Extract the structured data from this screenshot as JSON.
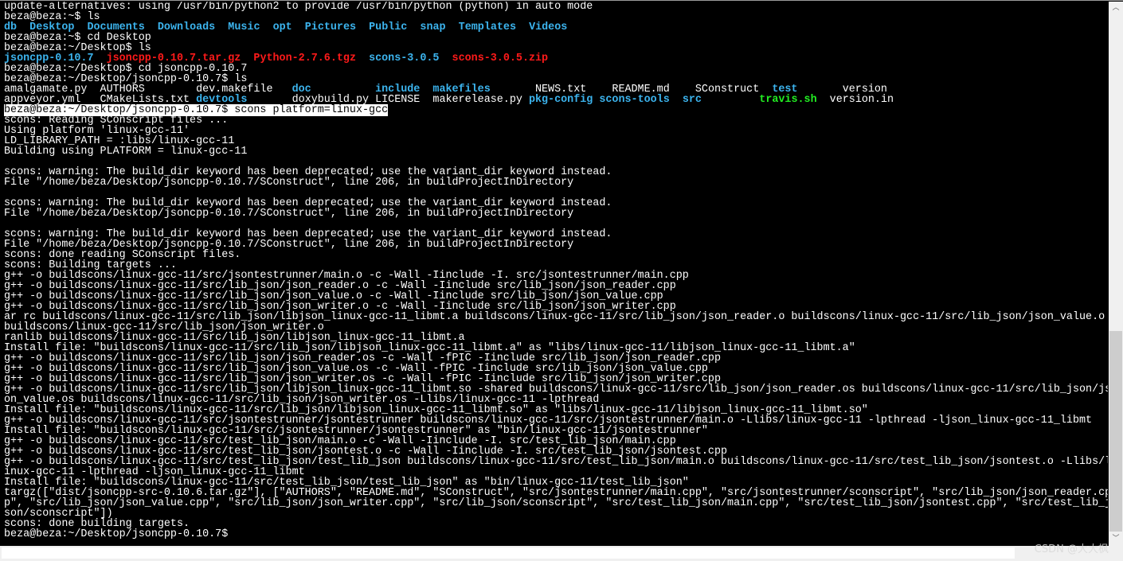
{
  "terminal": {
    "lines": [
      "update-alternatives: using /usr/bin/python2 to provide /usr/bin/python (python) in auto mode",
      "beza@beza:~$ ls",
      [
        [
          "db",
          "dir"
        ],
        [
          "  ",
          ""
        ],
        [
          "Desktop",
          "dir"
        ],
        [
          "  ",
          ""
        ],
        [
          "Documents",
          "dir"
        ],
        [
          "  ",
          ""
        ],
        [
          "Downloads",
          "dir"
        ],
        [
          "  ",
          ""
        ],
        [
          "Music",
          "dir"
        ],
        [
          "  ",
          ""
        ],
        [
          "opt",
          "dir"
        ],
        [
          "  ",
          ""
        ],
        [
          "Pictures",
          "dir"
        ],
        [
          "  ",
          ""
        ],
        [
          "Public",
          "dir"
        ],
        [
          "  ",
          ""
        ],
        [
          "snap",
          "dir"
        ],
        [
          "  ",
          ""
        ],
        [
          "Templates",
          "dir"
        ],
        [
          "  ",
          ""
        ],
        [
          "Videos",
          "dir"
        ]
      ],
      "beza@beza:~$ cd Desktop",
      "beza@beza:~/Desktop$ ls",
      [
        [
          "jsoncpp-0.10.7",
          "dir"
        ],
        [
          "  ",
          ""
        ],
        [
          "jsoncpp-0.10.7.tar.gz",
          "arc"
        ],
        [
          "  ",
          ""
        ],
        [
          "Python-2.7.6.tgz",
          "arc"
        ],
        [
          "  ",
          ""
        ],
        [
          "scons-3.0.5",
          "dir"
        ],
        [
          "  ",
          ""
        ],
        [
          "scons-3.0.5.zip",
          "arc"
        ]
      ],
      "beza@beza:~/Desktop$ cd jsoncpp-0.10.7",
      "beza@beza:~/Desktop/jsoncpp-0.10.7$ ls",
      [
        [
          "amalgamate.py  AUTHORS        dev.makefile   ",
          ""
        ],
        [
          "doc",
          "dir"
        ],
        [
          "          ",
          ""
        ],
        [
          "include",
          "dir"
        ],
        [
          "  ",
          ""
        ],
        [
          "makefiles",
          "dir"
        ],
        [
          "       NEWS.txt    README.md    SConstruct  ",
          ""
        ],
        [
          "test",
          "dir"
        ],
        [
          "       version",
          ""
        ]
      ],
      [
        [
          "appveyor.yml   CMakeLists.txt ",
          ""
        ],
        [
          "devtools",
          "dir"
        ],
        [
          "       doxybuild.py LICENSE  makerelease.py ",
          ""
        ],
        [
          "pkg-config",
          "dir"
        ],
        [
          " ",
          ""
        ],
        [
          "scons-tools",
          "dir"
        ],
        [
          "  ",
          ""
        ],
        [
          "src",
          "dir"
        ],
        [
          "         ",
          ""
        ],
        [
          "travis.sh",
          "exe"
        ],
        [
          "  version.in",
          ""
        ]
      ],
      [
        [
          "beza@beza:~/Desktop/jsoncpp-0.10.7$ scons platform=linux-gcc",
          "hl"
        ]
      ],
      "scons: Reading SConscript files ...",
      "Using platform 'linux-gcc-11'",
      "LD_LIBRARY_PATH = :libs/linux-gcc-11",
      "Building using PLATFORM = linux-gcc-11",
      "",
      "scons: warning: The build_dir keyword has been deprecated; use the variant_dir keyword instead.",
      "File \"/home/beza/Desktop/jsoncpp-0.10.7/SConstruct\", line 206, in buildProjectInDirectory",
      "",
      "scons: warning: The build_dir keyword has been deprecated; use the variant_dir keyword instead.",
      "File \"/home/beza/Desktop/jsoncpp-0.10.7/SConstruct\", line 206, in buildProjectInDirectory",
      "",
      "scons: warning: The build_dir keyword has been deprecated; use the variant_dir keyword instead.",
      "File \"/home/beza/Desktop/jsoncpp-0.10.7/SConstruct\", line 206, in buildProjectInDirectory",
      "scons: done reading SConscript files.",
      "scons: Building targets ...",
      "g++ -o buildscons/linux-gcc-11/src/jsontestrunner/main.o -c -Wall -Iinclude -I. src/jsontestrunner/main.cpp",
      "g++ -o buildscons/linux-gcc-11/src/lib_json/json_reader.o -c -Wall -Iinclude src/lib_json/json_reader.cpp",
      "g++ -o buildscons/linux-gcc-11/src/lib_json/json_value.o -c -Wall -Iinclude src/lib_json/json_value.cpp",
      "g++ -o buildscons/linux-gcc-11/src/lib_json/json_writer.o -c -Wall -Iinclude src/lib_json/json_writer.cpp",
      "ar rc buildscons/linux-gcc-11/src/lib_json/libjson_linux-gcc-11_libmt.a buildscons/linux-gcc-11/src/lib_json/json_reader.o buildscons/linux-gcc-11/src/lib_json/json_value.o",
      "buildscons/linux-gcc-11/src/lib_json/json_writer.o",
      "ranlib buildscons/linux-gcc-11/src/lib_json/libjson_linux-gcc-11_libmt.a",
      "Install file: \"buildscons/linux-gcc-11/src/lib_json/libjson_linux-gcc-11_libmt.a\" as \"libs/linux-gcc-11/libjson_linux-gcc-11_libmt.a\"",
      "g++ -o buildscons/linux-gcc-11/src/lib_json/json_reader.os -c -Wall -fPIC -Iinclude src/lib_json/json_reader.cpp",
      "g++ -o buildscons/linux-gcc-11/src/lib_json/json_value.os -c -Wall -fPIC -Iinclude src/lib_json/json_value.cpp",
      "g++ -o buildscons/linux-gcc-11/src/lib_json/json_writer.os -c -Wall -fPIC -Iinclude src/lib_json/json_writer.cpp",
      "g++ -o buildscons/linux-gcc-11/src/lib_json/libjson_linux-gcc-11_libmt.so -shared buildscons/linux-gcc-11/src/lib_json/json_reader.os buildscons/linux-gcc-11/src/lib_json/js",
      "on_value.os buildscons/linux-gcc-11/src/lib_json/json_writer.os -Llibs/linux-gcc-11 -lpthread",
      "Install file: \"buildscons/linux-gcc-11/src/lib_json/libjson_linux-gcc-11_libmt.so\" as \"libs/linux-gcc-11/libjson_linux-gcc-11_libmt.so\"",
      "g++ -o buildscons/linux-gcc-11/src/jsontestrunner/jsontestrunner buildscons/linux-gcc-11/src/jsontestrunner/main.o -Llibs/linux-gcc-11 -lpthread -ljson_linux-gcc-11_libmt",
      "Install file: \"buildscons/linux-gcc-11/src/jsontestrunner/jsontestrunner\" as \"bin/linux-gcc-11/jsontestrunner\"",
      "g++ -o buildscons/linux-gcc-11/src/test_lib_json/main.o -c -Wall -Iinclude -I. src/test_lib_json/main.cpp",
      "g++ -o buildscons/linux-gcc-11/src/test_lib_json/jsontest.o -c -Wall -Iinclude -I. src/test_lib_json/jsontest.cpp",
      "g++ -o buildscons/linux-gcc-11/src/test_lib_json/test_lib_json buildscons/linux-gcc-11/src/test_lib_json/main.o buildscons/linux-gcc-11/src/test_lib_json/jsontest.o -Llibs/l",
      "inux-gcc-11 -lpthread -ljson_linux-gcc-11_libmt",
      "Install file: \"buildscons/linux-gcc-11/src/test_lib_json/test_lib_json\" as \"bin/linux-gcc-11/test_lib_json\"",
      "targz([\"dist/jsoncpp-src-0.10.6.tar.gz\"], [\"AUTHORS\", \"README.md\", \"SConstruct\", \"src/jsontestrunner/main.cpp\", \"src/jsontestrunner/sconscript\", \"src/lib_json/json_reader.cp",
      "p\", \"src/lib_json/json_value.cpp\", \"src/lib_json/json_writer.cpp\", \"src/lib_json/sconscript\", \"src/test_lib_json/main.cpp\", \"src/test_lib_json/jsontest.cpp\", \"src/test_lib_j",
      "son/sconscript\"])",
      "scons: done building targets.",
      "beza@beza:~/Desktop/jsoncpp-0.10.7$"
    ]
  },
  "colors": {
    "background": "#000000",
    "foreground": "#ffffff",
    "directory": "#3cb4ee",
    "archive": "#ff1a1a",
    "executable": "#22ee22"
  },
  "scrollbar": {
    "up_icon": "chevron-up-icon",
    "down_icon": "chevron-down-icon",
    "up_glyph": "︿",
    "down_glyph": "﹀"
  },
  "watermark": "CSDN @大大枫"
}
